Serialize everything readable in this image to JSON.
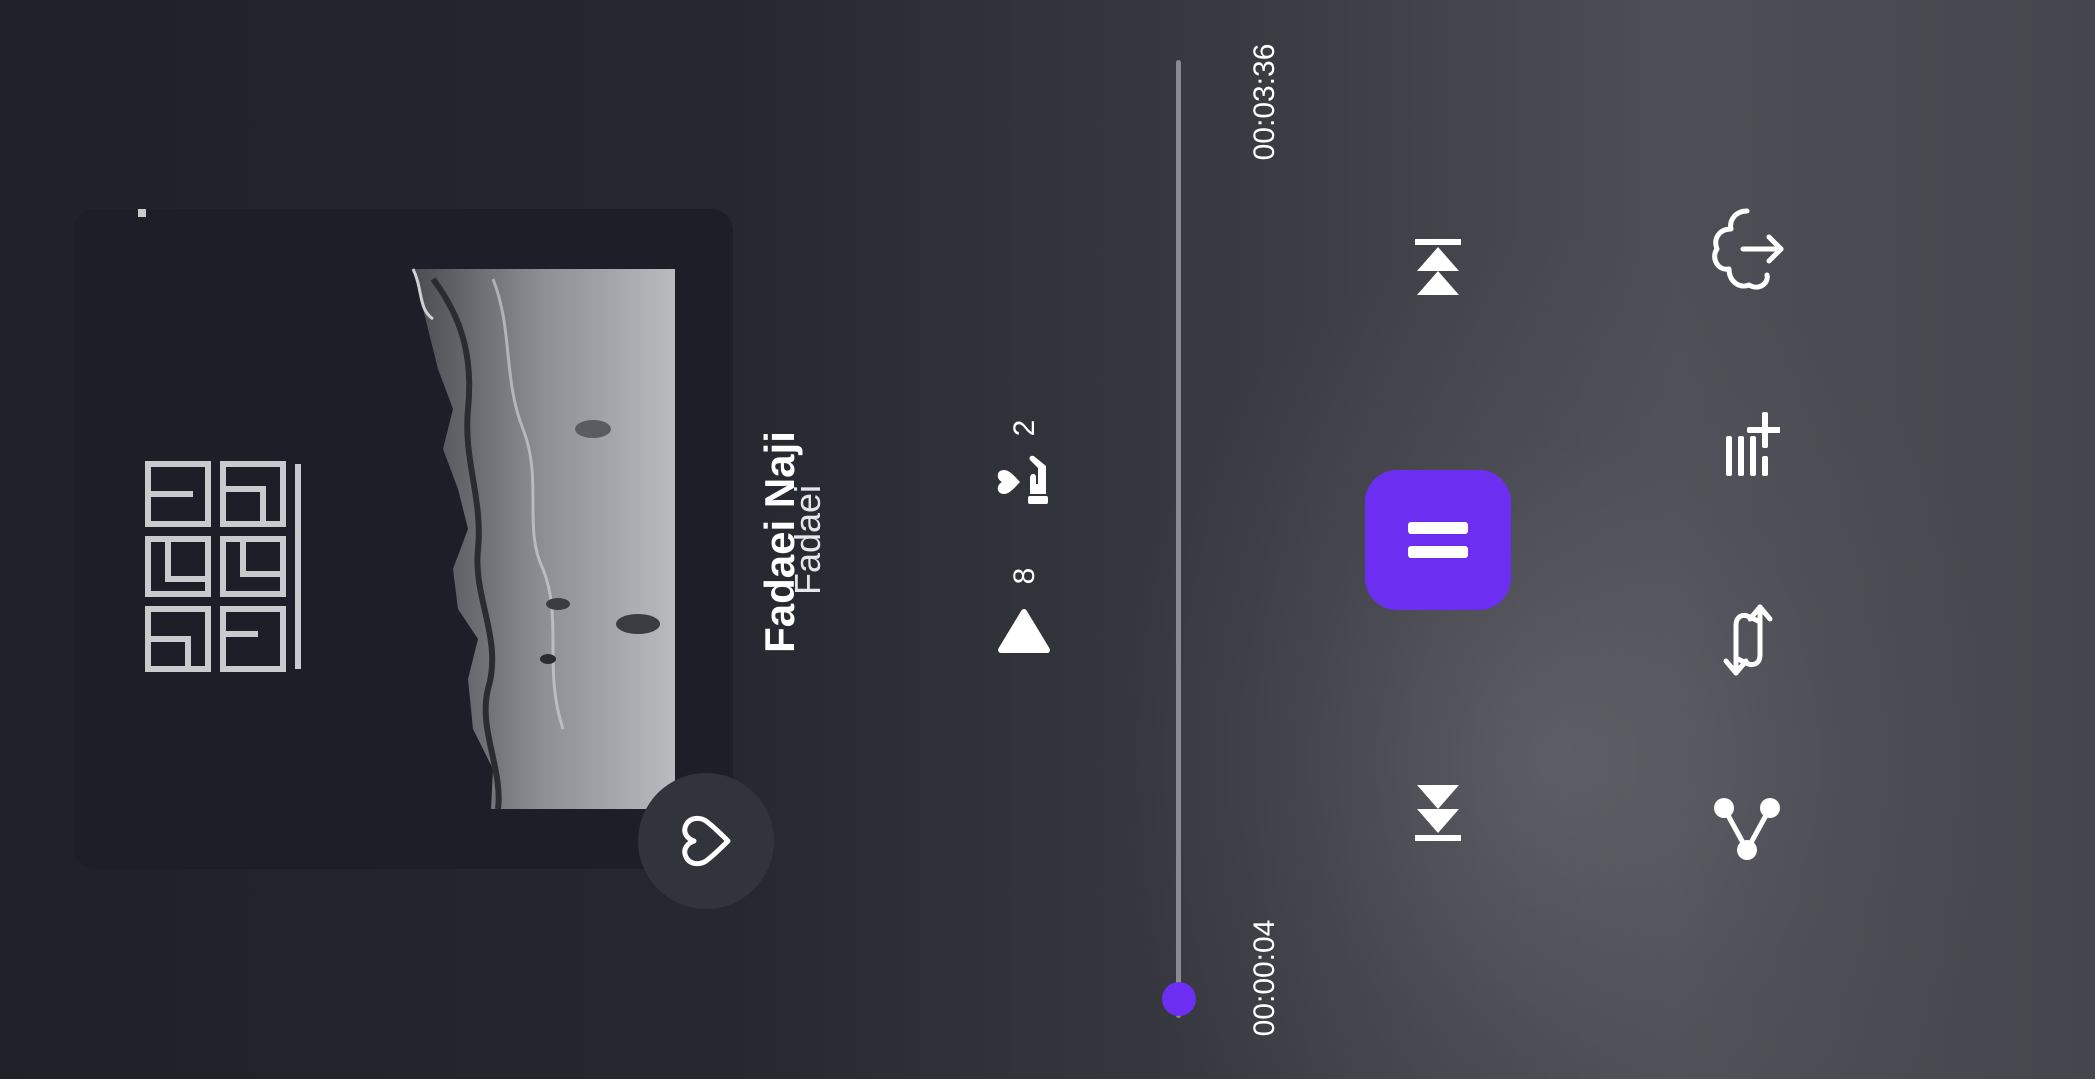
{
  "track": {
    "title": "Fadaei Naji",
    "artist": "Fadaei"
  },
  "stats": {
    "plays": "8",
    "likes": "2"
  },
  "progress": {
    "elapsed": "00:00:04",
    "total": "00:03:36",
    "fraction": 0.02
  },
  "colors": {
    "accent": "#6c2ff2",
    "card": "#1d1f28",
    "text": "#ffffff"
  },
  "icons": {
    "favorite": "heart-icon",
    "play_count": "play-triangle-icon",
    "likes": "hand-heart-icon",
    "previous": "skip-previous-icon",
    "play_pause": "pause-icon",
    "next": "skip-next-icon",
    "cloud": "cloud-share-icon",
    "add_to_playlist": "playlist-add-icon",
    "repeat": "repeat-icon",
    "share": "share-icon"
  }
}
